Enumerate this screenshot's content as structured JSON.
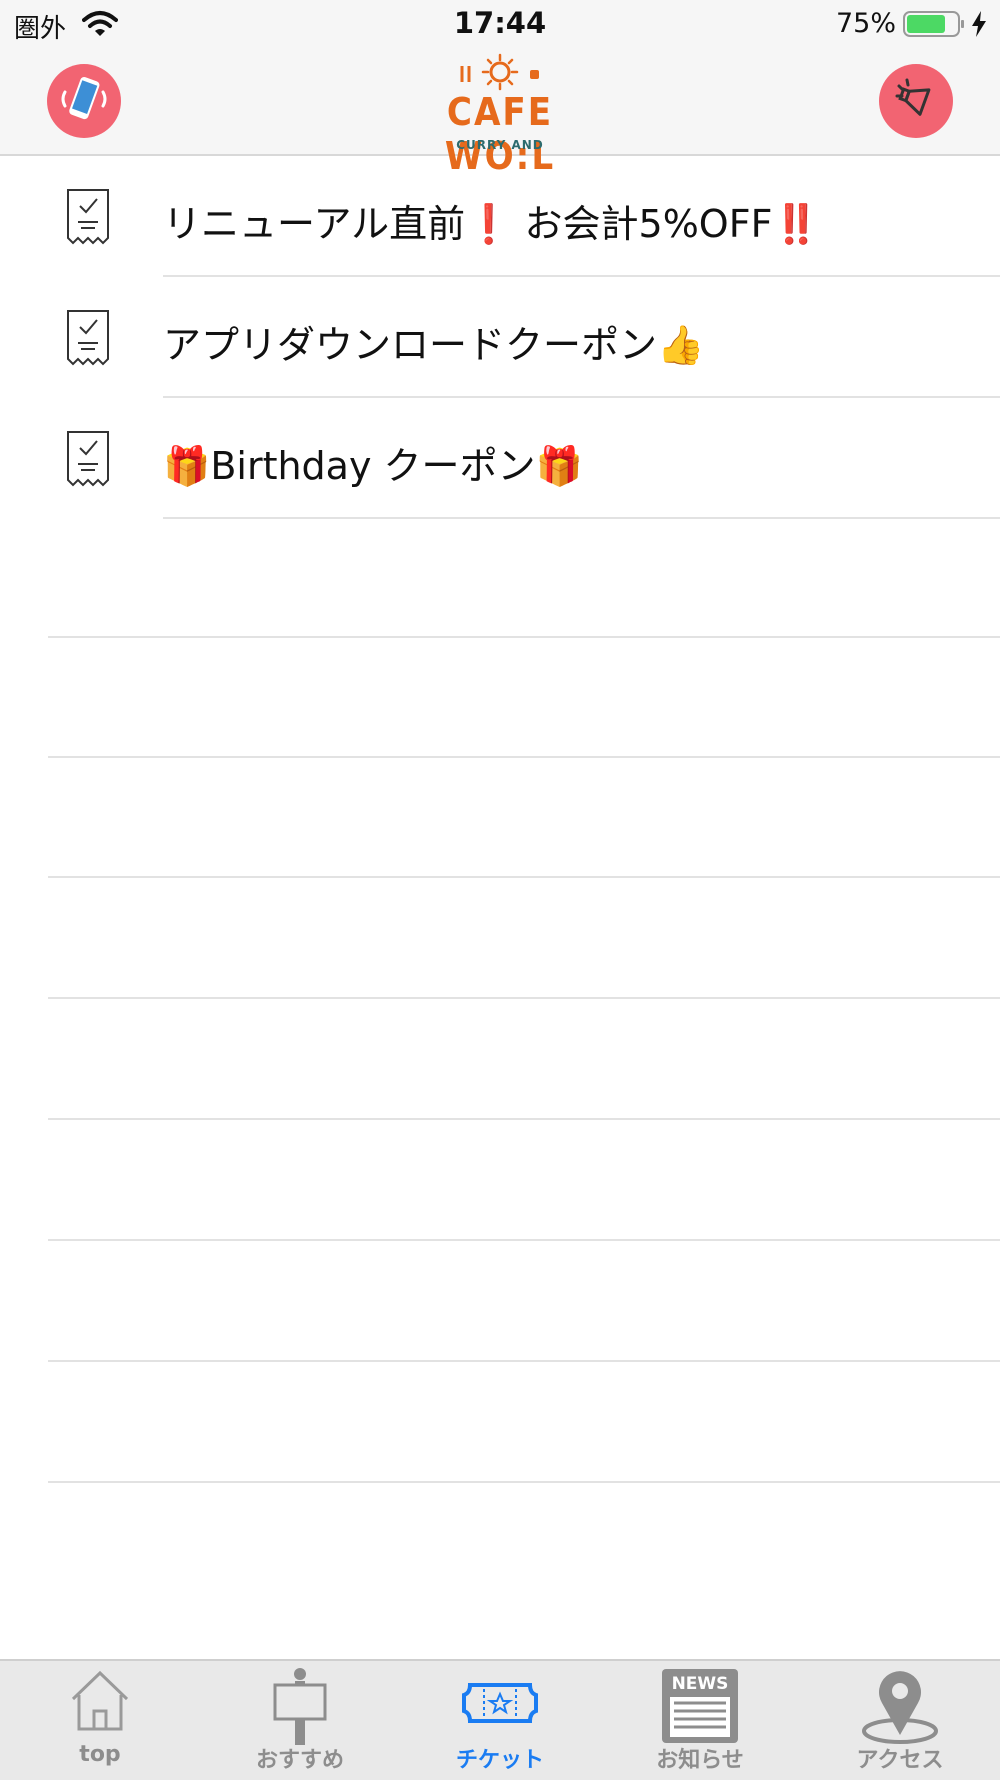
{
  "status_bar": {
    "carrier": "圏外",
    "time": "17:44",
    "battery_percent": "75%",
    "battery_level": 0.75,
    "charging": true
  },
  "header": {
    "logo_main": "CAFE WO:L",
    "logo_sub": "CURRY AND",
    "left_button_icon": "phone-call-icon",
    "right_button_icon": "megaphone-icon",
    "brand_color": "#f26472"
  },
  "coupons": [
    {
      "title": "リニューアル直前",
      "mark": "❗",
      "title2": " お会計5%OFF",
      "mark2": "‼️"
    },
    {
      "title": "アプリダウンロードクーポン",
      "emoji": "👍"
    },
    {
      "emoji_before": "🎁",
      "title": "Birthday クーポン",
      "emoji": "🎁"
    }
  ],
  "tabs": [
    {
      "label": "top",
      "icon": "house-icon",
      "active": false
    },
    {
      "label": "おすすめ",
      "icon": "signboard-icon",
      "active": false
    },
    {
      "label": "チケット",
      "icon": "ticket-icon",
      "active": true
    },
    {
      "label": "お知らせ",
      "icon": "news-icon",
      "active": false
    },
    {
      "label": "アクセス",
      "icon": "map-pin-icon",
      "active": false
    }
  ],
  "news_icon_text": "NEWS",
  "accent_color": "#1a7cf2"
}
